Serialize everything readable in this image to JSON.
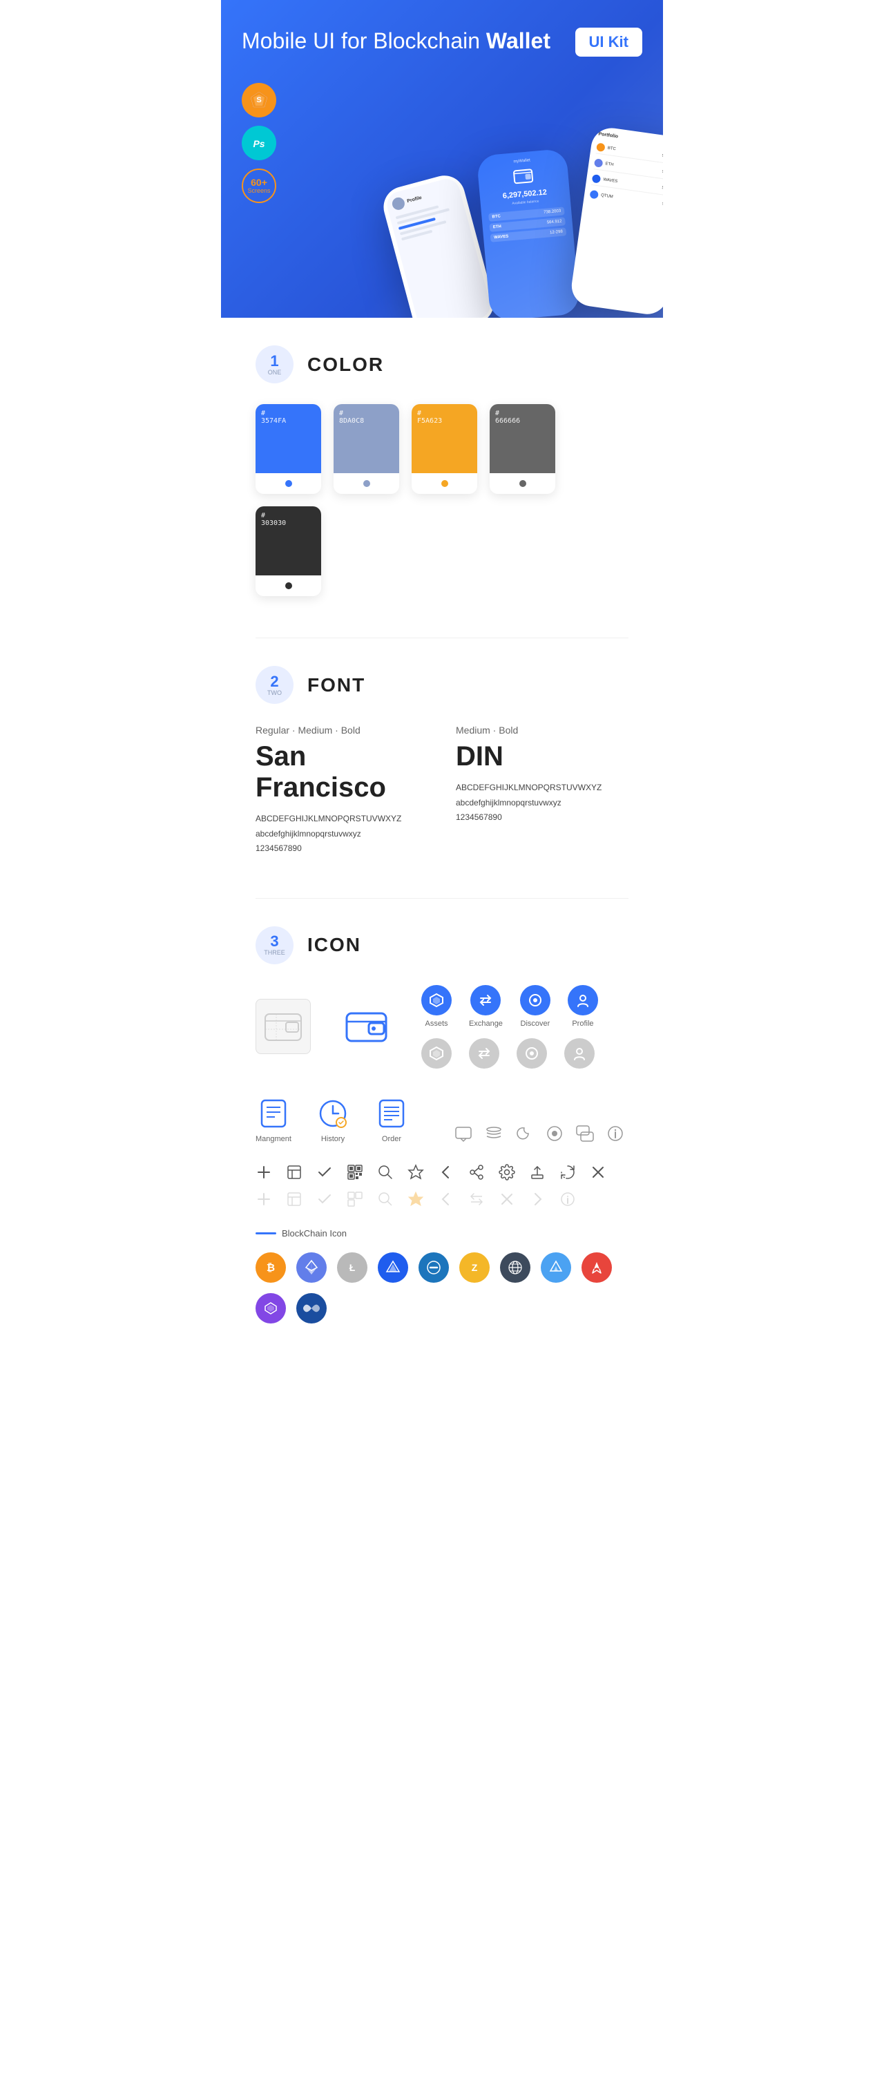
{
  "hero": {
    "title_regular": "Mobile UI for Blockchain ",
    "title_bold": "Wallet",
    "badge": "UI Kit",
    "badge_sketch": "S",
    "badge_ps": "Ps",
    "badge_screens_top": "60+",
    "badge_screens_bottom": "Screens"
  },
  "sections": {
    "color": {
      "number": "1",
      "word": "ONE",
      "title": "COLOR",
      "swatches": [
        {
          "hex": "#3574FA",
          "code": "#\n3574FA",
          "dot": "#3574FA"
        },
        {
          "hex": "#8DA0C8",
          "code": "#\n8DA0C8",
          "dot": "#8DA0C8"
        },
        {
          "hex": "#F5A623",
          "code": "#\nF5A623",
          "dot": "#F5A623"
        },
        {
          "hex": "#666666",
          "code": "#\n666666",
          "dot": "#666666"
        },
        {
          "hex": "#303030",
          "code": "#\n303030",
          "dot": "#303030"
        }
      ]
    },
    "font": {
      "number": "2",
      "word": "TWO",
      "title": "FONT",
      "font1": {
        "weights": "Regular · Medium · Bold",
        "name": "San Francisco",
        "abc_upper": "ABCDEFGHIJKLMNOPQRSTUVWXYZ",
        "abc_lower": "abcdefghijklmnopqrstuvwxyz",
        "numbers": "1234567890"
      },
      "font2": {
        "weights": "Medium · Bold",
        "name": "DIN",
        "abc_upper": "ABCDEFGHIJKLMNOPQRSTUVWXYZ",
        "abc_lower": "abcdefghijklmnopqrstuvwxyz",
        "numbers": "1234567890"
      }
    },
    "icon": {
      "number": "3",
      "word": "THREE",
      "title": "ICON",
      "nav_icons": [
        {
          "label": "Assets"
        },
        {
          "label": "Exchange"
        },
        {
          "label": "Discover"
        },
        {
          "label": "Profile"
        }
      ],
      "app_icons": [
        {
          "label": "Mangment"
        },
        {
          "label": "History"
        },
        {
          "label": "Order"
        }
      ],
      "blockchain_label": "BlockChain Icon",
      "crypto_icons": [
        "BTC",
        "ETH",
        "LTC",
        "WAVES",
        "DASH",
        "ZEC",
        "GRID",
        "STEEM",
        "ARK",
        "MATIC",
        "BLU"
      ]
    }
  }
}
